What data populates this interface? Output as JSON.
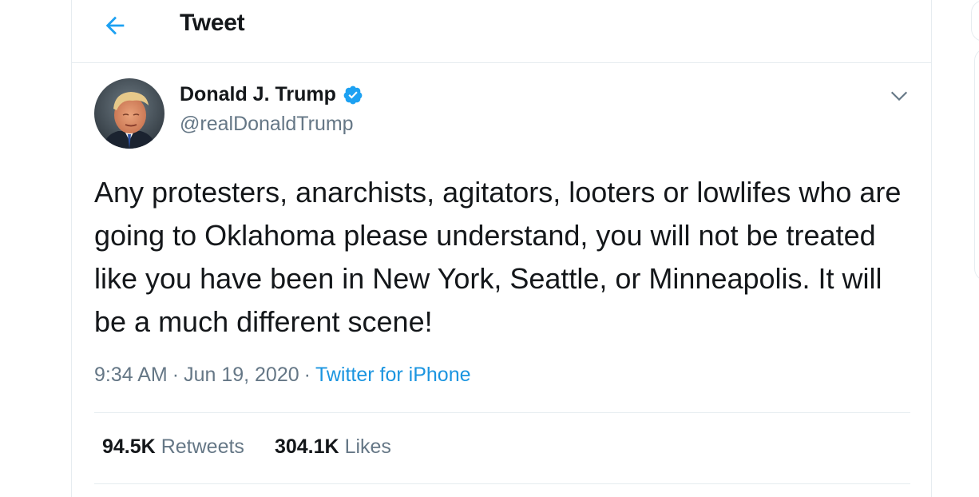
{
  "header": {
    "back_icon": "arrow-left-icon",
    "title": "Tweet"
  },
  "tweet": {
    "author": {
      "display_name": "Donald J. Trump",
      "handle": "@realDonaldTrump",
      "verified": true
    },
    "text": "Any protesters, anarchists, agitators, looters or lowlifes who are going to Oklahoma please understand, you will not be treated like you have been in New York, Seattle, or Minneapolis. It will be a much different scene!",
    "time": "9:34 AM",
    "date": "Jun 19, 2020",
    "separator": "·",
    "source": "Twitter for iPhone",
    "stats": {
      "retweets_count": "94.5K",
      "retweets_label": "Retweets",
      "likes_count": "304.1K",
      "likes_label": "Likes"
    }
  },
  "colors": {
    "accent": "#1da1f2",
    "link": "#1b95e0",
    "text_primary": "#14171a",
    "text_secondary": "#657786",
    "border": "#e6ecf0"
  }
}
